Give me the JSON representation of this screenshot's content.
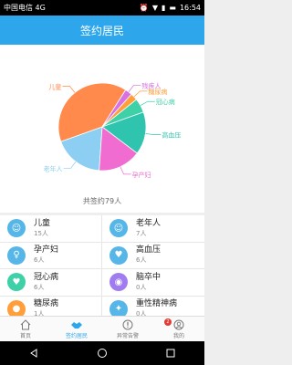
{
  "status_bar": {
    "carrier": "中国电信 4G",
    "time": "16:54"
  },
  "header": {
    "title": "签约居民"
  },
  "chart_data": {
    "type": "pie",
    "slices": [
      {
        "label": "儿童",
        "value": 15,
        "color": "#ff8a4c"
      },
      {
        "label": "老年人",
        "value": 7,
        "color": "#8ccff3"
      },
      {
        "label": "孕产妇",
        "value": 6,
        "color": "#f06cd0"
      },
      {
        "label": "高血压",
        "value": 6,
        "color": "#2fc4ad"
      },
      {
        "label": "冠心病",
        "value": 2,
        "color": "#3ed0a6"
      },
      {
        "label": "糖尿病",
        "value": 1,
        "color": "#ff9e3a"
      },
      {
        "label": "残疾人",
        "value": 1,
        "color": "#d86fe2"
      }
    ]
  },
  "summary": {
    "total_text": "共签约79人"
  },
  "categories": [
    {
      "name": "儿童",
      "count": "15人",
      "color": "#56b6e8",
      "icon": "☺"
    },
    {
      "name": "老年人",
      "count": "7人",
      "color": "#56b6e8",
      "icon": "☺"
    },
    {
      "name": "孕产妇",
      "count": "6人",
      "color": "#56b6e8",
      "icon": "♀"
    },
    {
      "name": "高血压",
      "count": "6人",
      "color": "#56b6e8",
      "icon": "♥"
    },
    {
      "name": "冠心病",
      "count": "6人",
      "color": "#3ed0a6",
      "icon": "♥"
    },
    {
      "name": "脑卒中",
      "count": "0人",
      "color": "#9f7df0",
      "icon": "◉"
    },
    {
      "name": "糖尿病",
      "count": "1人",
      "color": "#ff9e3a",
      "icon": "●"
    },
    {
      "name": "重性精神病",
      "count": "0人",
      "color": "#56b6e8",
      "icon": "✦"
    }
  ],
  "tabs": [
    {
      "label": "首页",
      "icon": "home-icon"
    },
    {
      "label": "签约居民",
      "icon": "handshake-icon"
    },
    {
      "label": "异常告警",
      "icon": "alert-icon",
      "badge": "2"
    },
    {
      "label": "我的",
      "icon": "user-icon"
    }
  ]
}
